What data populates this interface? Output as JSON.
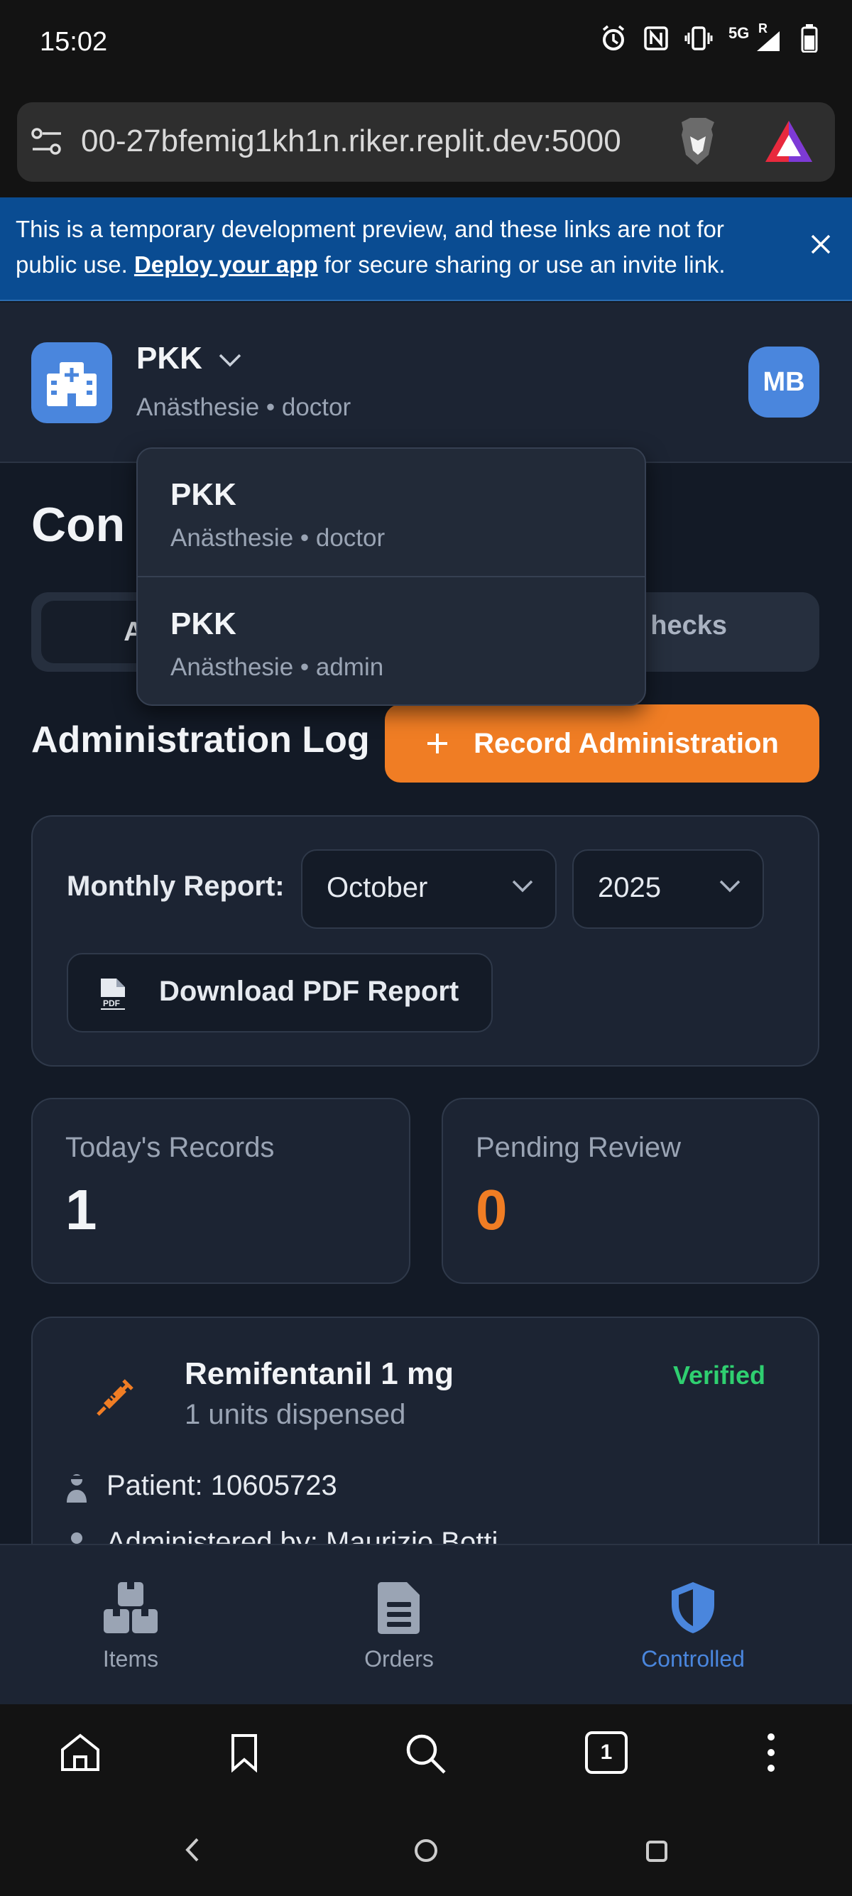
{
  "status_bar": {
    "time": "15:02",
    "network": "5G",
    "roaming": "R"
  },
  "browser": {
    "url": "00-27bfemig1kh1n.riker.replit.dev:5000"
  },
  "banner": {
    "text_before": "This is a temporary development preview, and these links are not for public use. ",
    "link": "Deploy your app",
    "text_after": " for secure sharing or use an invite link."
  },
  "header": {
    "hospital": "PKK",
    "subtitle": "Anästhesie • doctor",
    "avatar_initials": "MB"
  },
  "dropdown": {
    "items": [
      {
        "name": "PKK",
        "sub": "Anästhesie • doctor"
      },
      {
        "name": "PKK",
        "sub": "Anästhesie • admin"
      }
    ]
  },
  "page": {
    "title_visible": "Con",
    "tab_active_visible": "A",
    "tab_right_visible": "hecks",
    "section_title": "Administration Log",
    "record_button": "Record Administration"
  },
  "report": {
    "label": "Monthly Report:",
    "month": "October",
    "year": "2025",
    "download_button": "Download PDF Report"
  },
  "stats": [
    {
      "label": "Today's Records",
      "value": "1",
      "color": "#f2f4f7"
    },
    {
      "label": "Pending Review",
      "value": "0",
      "color": "#f07d24"
    }
  ],
  "record": {
    "drug": "Remifentanil 1 mg",
    "dispensed": "1 units dispensed",
    "status": "Verified",
    "status_color": "#2fcf70",
    "patient": "Patient: 10605723",
    "administered_by": "Administered by: Maurizio Botti"
  },
  "bottom_nav": [
    {
      "label": "Items",
      "icon": "boxes-icon"
    },
    {
      "label": "Orders",
      "icon": "clipboard-icon"
    },
    {
      "label": "Controlled",
      "icon": "shield-icon",
      "active": true
    }
  ],
  "browser_bar": {
    "tab_count": "1"
  },
  "colors": {
    "accent": "#4a86dd",
    "orange": "#f07d24",
    "banner": "#0a4c92"
  }
}
